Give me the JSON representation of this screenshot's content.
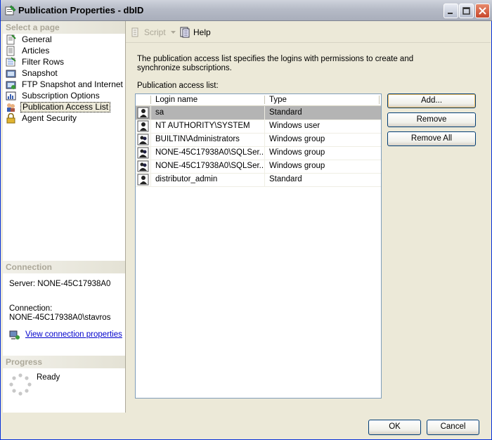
{
  "window": {
    "title": "Publication Properties - dbID"
  },
  "left": {
    "select_page_header": "Select a page",
    "pages": [
      {
        "label": "General",
        "icon": "page-icon"
      },
      {
        "label": "Articles",
        "icon": "page-icon"
      },
      {
        "label": "Filter Rows",
        "icon": "filter-icon"
      },
      {
        "label": "Snapshot",
        "icon": "snapshot-icon"
      },
      {
        "label": "FTP Snapshot and Internet",
        "icon": "ftp-icon"
      },
      {
        "label": "Subscription Options",
        "icon": "options-icon"
      },
      {
        "label": "Publication Access List",
        "icon": "users-icon"
      },
      {
        "label": "Agent Security",
        "icon": "lock-icon"
      }
    ],
    "connection_header": "Connection",
    "server_text": "Server: NONE-45C17938A0",
    "connection_label": "Connection:",
    "connection_value": "NONE-45C17938A0\\stavros",
    "view_connection_link": "View connection properties",
    "progress_header": "Progress",
    "progress_status": "Ready"
  },
  "toolbar": {
    "script_label": "Script",
    "help_label": "Help"
  },
  "main": {
    "description": "The publication access list specifies the logins with permissions to create and synchronize subscriptions.",
    "list_label": "Publication access list:",
    "columns": {
      "login": "Login name",
      "type": "Type"
    },
    "rows": [
      {
        "login": "sa",
        "type": "Standard"
      },
      {
        "login": "NT AUTHORITY\\SYSTEM",
        "type": "Windows user"
      },
      {
        "login": "BUILTIN\\Administrators",
        "type": "Windows group"
      },
      {
        "login": "NONE-45C17938A0\\SQLSer...",
        "type": "Windows group"
      },
      {
        "login": "NONE-45C17938A0\\SQLSer...",
        "type": "Windows group"
      },
      {
        "login": "distributor_admin",
        "type": "Standard"
      }
    ],
    "add_label": "Add...",
    "remove_label": "Remove",
    "remove_all_label": "Remove All"
  },
  "footer": {
    "ok_label": "OK",
    "cancel_label": "Cancel"
  }
}
